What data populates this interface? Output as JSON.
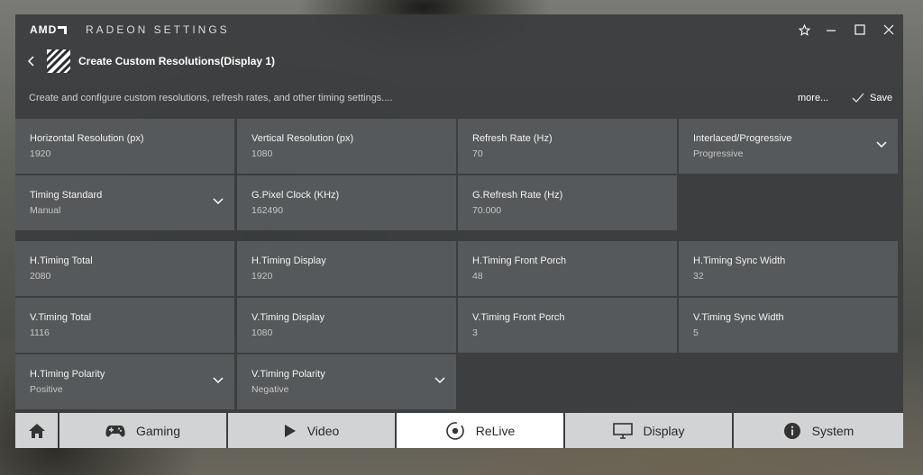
{
  "app": {
    "brand": "AMD",
    "title": "RADEON SETTINGS"
  },
  "header": {
    "page_title": "Create Custom Resolutions(Display 1)",
    "subtitle": "Create and configure custom resolutions, refresh rates, and other timing settings....",
    "more_label": "more...",
    "save_label": "Save"
  },
  "fields": [
    {
      "label": "Horizontal Resolution (px)",
      "value": "1920"
    },
    {
      "label": "Vertical Resolution (px)",
      "value": "1080"
    },
    {
      "label": "Refresh Rate (Hz)",
      "value": "70"
    },
    {
      "label": "Interlaced/Progressive",
      "value": "Progressive"
    },
    {
      "label": "Timing Standard",
      "value": "Manual"
    },
    {
      "label": "G.Pixel Clock (KHz)",
      "value": "162490"
    },
    {
      "label": "G.Refresh Rate (Hz)",
      "value": "70.000"
    },
    {
      "label": "H.Timing Total",
      "value": "2080"
    },
    {
      "label": "H.Timing Display",
      "value": "1920"
    },
    {
      "label": "H.Timing Front Porch",
      "value": "48"
    },
    {
      "label": "H.Timing Sync Width",
      "value": "32"
    },
    {
      "label": "V.Timing Total",
      "value": "1116"
    },
    {
      "label": "V.Timing Display",
      "value": "1080"
    },
    {
      "label": "V.Timing Front Porch",
      "value": "3"
    },
    {
      "label": "V.Timing Sync Width",
      "value": "5"
    },
    {
      "label": "H.Timing Polarity",
      "value": "Positive"
    },
    {
      "label": "V.Timing Polarity",
      "value": "Negative"
    }
  ],
  "nav": {
    "tabs": [
      {
        "label": "Gaming",
        "icon": "gamepad-icon"
      },
      {
        "label": "Video",
        "icon": "play-icon"
      },
      {
        "label": "ReLive",
        "icon": "relive-icon"
      },
      {
        "label": "Display",
        "icon": "monitor-icon"
      },
      {
        "label": "System",
        "icon": "info-icon"
      }
    ],
    "active": "ReLive"
  }
}
